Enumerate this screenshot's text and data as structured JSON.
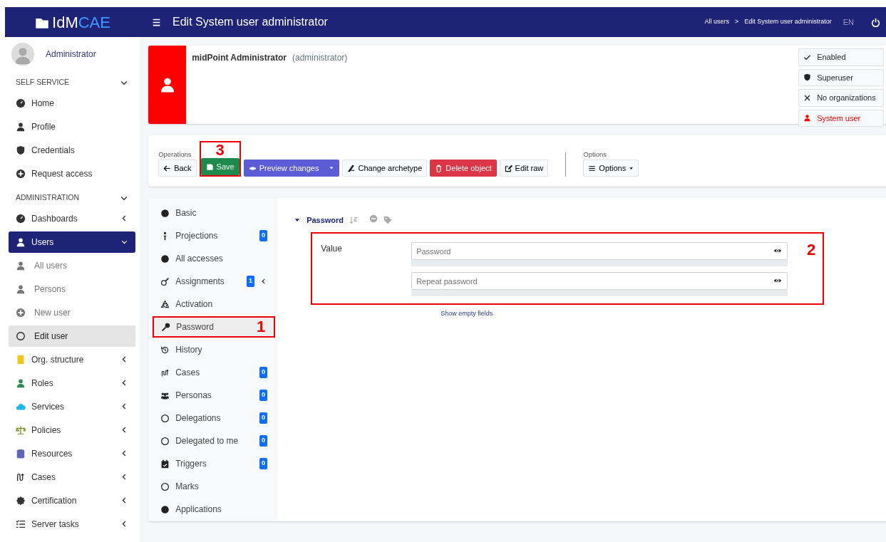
{
  "brand": {
    "text": "IdM",
    "accent": "CAE"
  },
  "header": {
    "title": "Edit System user administrator",
    "breadcrumbs": [
      "All users",
      ">",
      "Edit System user administrator"
    ],
    "language": "EN",
    "language_muted": true
  },
  "sidebar": {
    "user": "Administrator",
    "sections": [
      {
        "title": "SELF SERVICE",
        "expanded": true,
        "items": [
          {
            "label": "Home"
          },
          {
            "label": "Profile"
          },
          {
            "label": "Credentials"
          },
          {
            "label": "Request access"
          }
        ]
      },
      {
        "title": "ADMINISTRATION",
        "expanded": true,
        "items": [
          {
            "label": "Dashboards",
            "selected": false,
            "expanded": false
          },
          {
            "label": "Users",
            "selected": true,
            "expanded": true,
            "children": [
              {
                "label": "All users",
                "selected": false
              },
              {
                "label": "Persons",
                "selected": false
              },
              {
                "label": "New user",
                "selected": false
              },
              {
                "label": "Edit user",
                "selected": true
              }
            ]
          },
          {
            "label": "Org. structure",
            "selected": false,
            "expanded": false
          },
          {
            "label": "Roles",
            "selected": false,
            "expanded": false
          },
          {
            "label": "Services",
            "selected": false,
            "expanded": false
          },
          {
            "label": "Policies",
            "selected": false,
            "expanded": false
          },
          {
            "label": "Resources",
            "selected": false,
            "expanded": false
          },
          {
            "label": "Cases",
            "selected": false,
            "expanded": false
          },
          {
            "label": "Certification",
            "selected": false,
            "expanded": false
          },
          {
            "label": "Server tasks",
            "selected": false,
            "expanded": false
          }
        ]
      }
    ]
  },
  "summary": {
    "name": "midPoint Administrator",
    "id": "(administrator)",
    "tags": [
      {
        "label": "Enabled",
        "color": "#212529"
      },
      {
        "label": "Superuser",
        "color": "#212529"
      },
      {
        "label": "No organizations",
        "color": "#212529"
      },
      {
        "label": "System user",
        "color": "#ff0000"
      }
    ]
  },
  "operations": {
    "label": "Operations",
    "buttons": [
      {
        "label": "Back",
        "kind": "light"
      },
      {
        "label": "Save",
        "kind": "success",
        "callout": "3"
      },
      {
        "label": "Preview changes",
        "kind": "split"
      },
      {
        "label": "Change archetype",
        "kind": "light"
      },
      {
        "label": "Delete object",
        "kind": "danger"
      },
      {
        "label": "Edit raw",
        "kind": "light"
      }
    ]
  },
  "options": {
    "label": "Options",
    "button": "Options"
  },
  "tabs": [
    {
      "label": "Basic",
      "selected": false
    },
    {
      "label": "Projections",
      "badge": "0",
      "selected": false
    },
    {
      "label": "All accesses",
      "selected": false
    },
    {
      "label": "Assignments",
      "badge": "1",
      "selected": false
    },
    {
      "label": "Activation",
      "selected": false
    },
    {
      "label": "Password",
      "selected": true,
      "callout": "1"
    },
    {
      "label": "History",
      "selected": false
    },
    {
      "label": "Cases",
      "badge": "0",
      "selected": false
    },
    {
      "label": "Personas",
      "badge": "0",
      "selected": false
    },
    {
      "label": "Delegations",
      "badge": "0",
      "selected": false
    },
    {
      "label": "Delegated to me",
      "badge": "0",
      "selected": false
    },
    {
      "label": "Triggers",
      "badge": "0",
      "selected": false
    },
    {
      "label": "Marks",
      "selected": false
    },
    {
      "label": "Applications",
      "selected": false
    }
  ],
  "panel": {
    "title": "Password",
    "expanded": true,
    "field": {
      "label": "Value",
      "callout": "2",
      "inputs": [
        {
          "placeholder": "Password"
        },
        {
          "placeholder": "Repeat password"
        }
      ]
    },
    "link": "Show empty fields"
  }
}
